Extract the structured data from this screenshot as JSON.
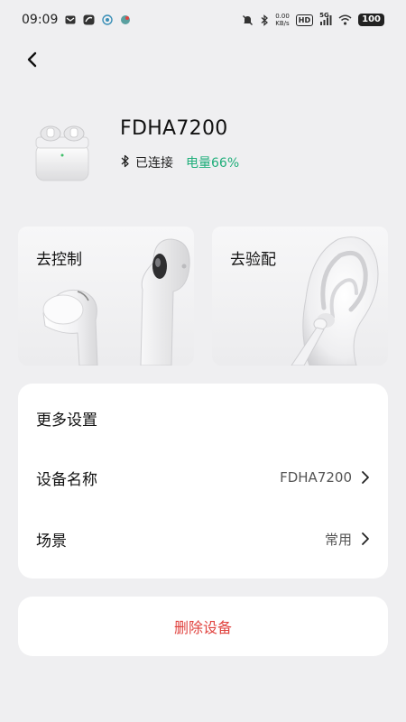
{
  "status_bar": {
    "time": "09:09",
    "net_speed_value": "0.00",
    "net_speed_unit": "KB/s",
    "hd_label": "HD",
    "signal_label": "5G",
    "battery": "100"
  },
  "nav": {
    "back_icon": "chevron-left-icon"
  },
  "device": {
    "name": "FDHA7200",
    "connection_status": "已连接",
    "battery_level": "电量66%",
    "battery_color": "#1fae7a"
  },
  "cards": {
    "control_label": "去控制",
    "fit_label": "去验配"
  },
  "settings": {
    "title": "更多设置",
    "device_name_label": "设备名称",
    "device_name_value": "FDHA7200",
    "scene_label": "场景",
    "scene_value": "常用"
  },
  "delete_label": "删除设备",
  "delete_color": "#e0433f"
}
